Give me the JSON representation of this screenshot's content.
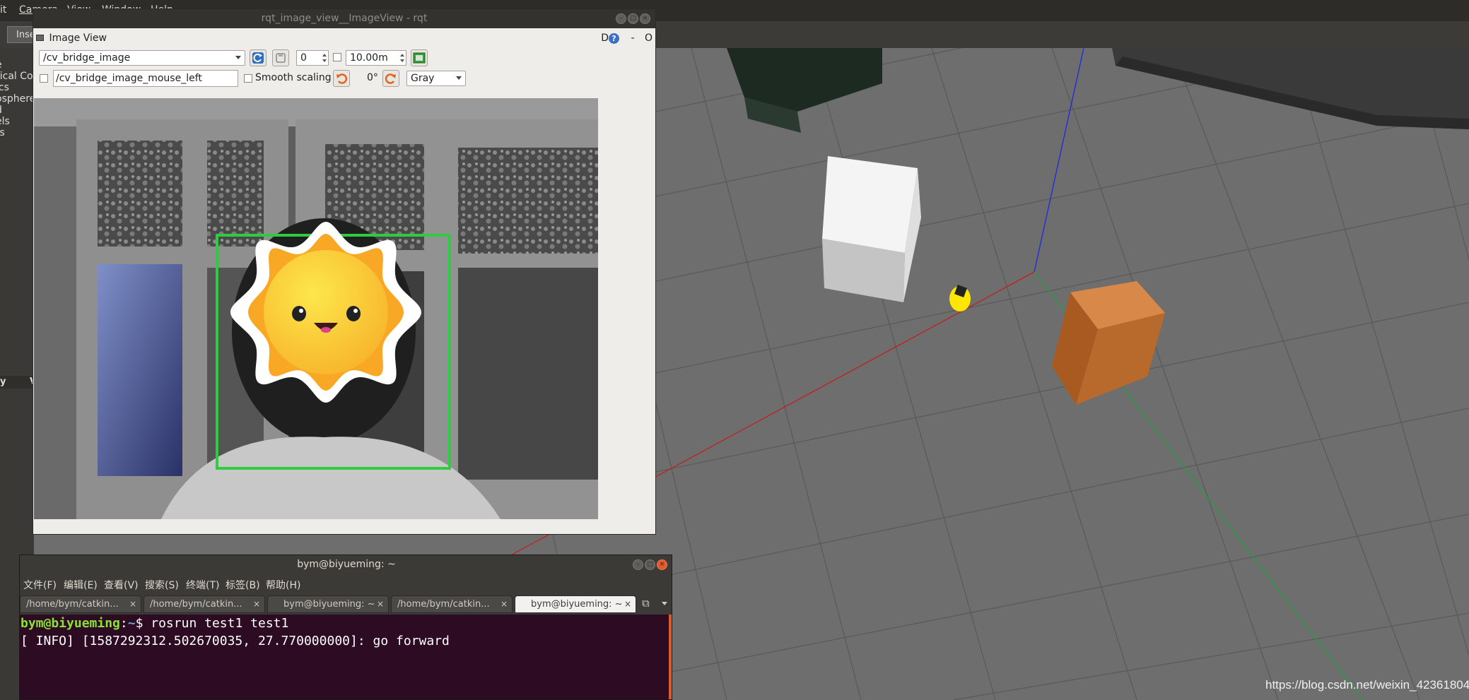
{
  "gazebo": {
    "menu": [
      "it",
      "Camera",
      "View",
      "Window",
      "Help"
    ],
    "insert_tab": "Inse",
    "tree_items": [
      "e",
      "rical Co",
      "ics",
      "osphere",
      "d",
      "els",
      "ts"
    ],
    "property_headers": [
      "y",
      "V"
    ],
    "watermark": "https://blog.csdn.net/weixin_42361804"
  },
  "rqt": {
    "window_title": "rqt_image_view__ImageView - rqt",
    "dock_title": "Image View",
    "dock_buttons": {
      "d_label": "D",
      "help": "?",
      "minimize": "-",
      "close": "O"
    },
    "topic": "/cv_bridge_image",
    "spin_value": "0",
    "max_range": "10.00m",
    "mouse_topic": "/cv_bridge_image_mouse_left",
    "smooth_scaling_label": "Smooth scaling",
    "rotation": "0°",
    "color_scheme": "Gray"
  },
  "terminal": {
    "window_title": "bym@biyueming: ~",
    "menu": [
      "文件(F)",
      "编辑(E)",
      "查看(V)",
      "搜索(S)",
      "终端(T)",
      "标签(B)",
      "帮助(H)"
    ],
    "tabs": [
      "/home/bym/catkin...",
      "/home/bym/catkin...",
      "bym@biyueming: ~",
      "/home/bym/catkin...",
      "bym@biyueming: ~"
    ],
    "prompt_user": "bym@biyueming",
    "prompt_sep": ":",
    "prompt_path": "~",
    "prompt_dollar": "$",
    "command": " rosrun test1 test1",
    "output": "[ INFO] [1587292312.502670035, 27.770000000]: go forward"
  },
  "colors": {
    "detection_box": "#2ecc40",
    "terminal_bg": "#2c0b23",
    "prompt_user": "#8ae234",
    "prompt_path": "#729fcf",
    "sun_outer": "#f9a825",
    "sun_face": "#ffd54f"
  },
  "icons": [
    "refresh-icon",
    "save-icon",
    "rotate-left-icon",
    "rotate-right-icon",
    "help-icon",
    "close-icon",
    "tab-new-icon",
    "tab-menu-icon"
  ]
}
